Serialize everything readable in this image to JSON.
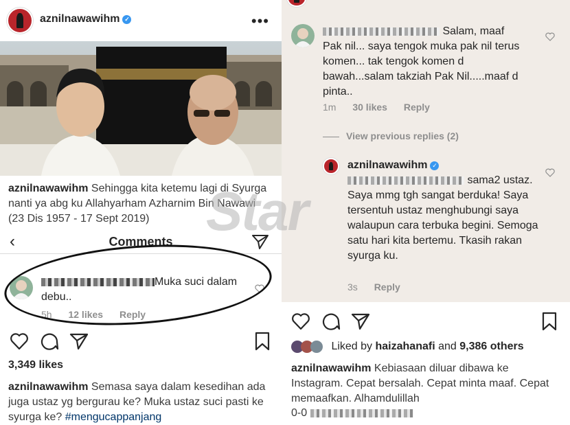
{
  "left": {
    "username": "aznilnawawihm",
    "caption_user": "aznilnawawihm",
    "caption_text": "Sehingga kita ketemu lagi di Syurga nanti ya abg ku Allahyarham Azharnim Bin Nawawi (23 Dis 1957 - 17 Sept 2019)",
    "comments_title": "Comments",
    "comment": {
      "text": "Muka suci dalam debu..",
      "time": "5h",
      "likes": "12 likes",
      "reply": "Reply"
    },
    "likes_count": "3,349 likes",
    "post_caption_user": "aznilnawawihm",
    "post_caption_text": "Semasa saya dalam kesedihan ada juga ustaz yg bergurau ke? Muka ustaz suci pasti ke syurga ke?",
    "post_hashtag": "#mengucappanjang"
  },
  "right": {
    "comment1": {
      "text": "Salam, maaf Pak nil... saya tengok muka pak nil terus komen... tak tengok komen d bawah...salam takziah Pak Nil.....maaf d pinta..",
      "time": "1m",
      "likes": "30 likes",
      "reply": "Reply"
    },
    "view_replies": "View previous replies (2)",
    "reply": {
      "username": "aznilnawawihm",
      "text": "sama2 ustaz. Saya mmg tgh sangat berduka! Saya tersentuh ustaz menghubungi saya walaupun cara terbuka begini. Semoga satu hari kita bertemu. Tkasih rakan syurga ku.",
      "time": "3s",
      "reply_label": "Reply"
    },
    "liked_by_prefix": "Liked by",
    "liked_by_user": "haizahanafi",
    "liked_by_and": "and",
    "liked_by_others": "9,386 others",
    "caption_user": "aznilnawawihm",
    "caption_text": "Kebiasaan diluar dibawa ke Instagram. Cepat bersalah. Cepat minta maaf. Cepat memaafkan. Alhamdulillah",
    "footer_prefix": "0-0"
  },
  "watermark_text": "Star",
  "colors": {
    "link_blue": "#003569",
    "verified_blue": "#3897f0",
    "meta_gray": "#8e8e8e",
    "comment_bg": "#f1ece7",
    "brand_red": "#b9252b"
  }
}
